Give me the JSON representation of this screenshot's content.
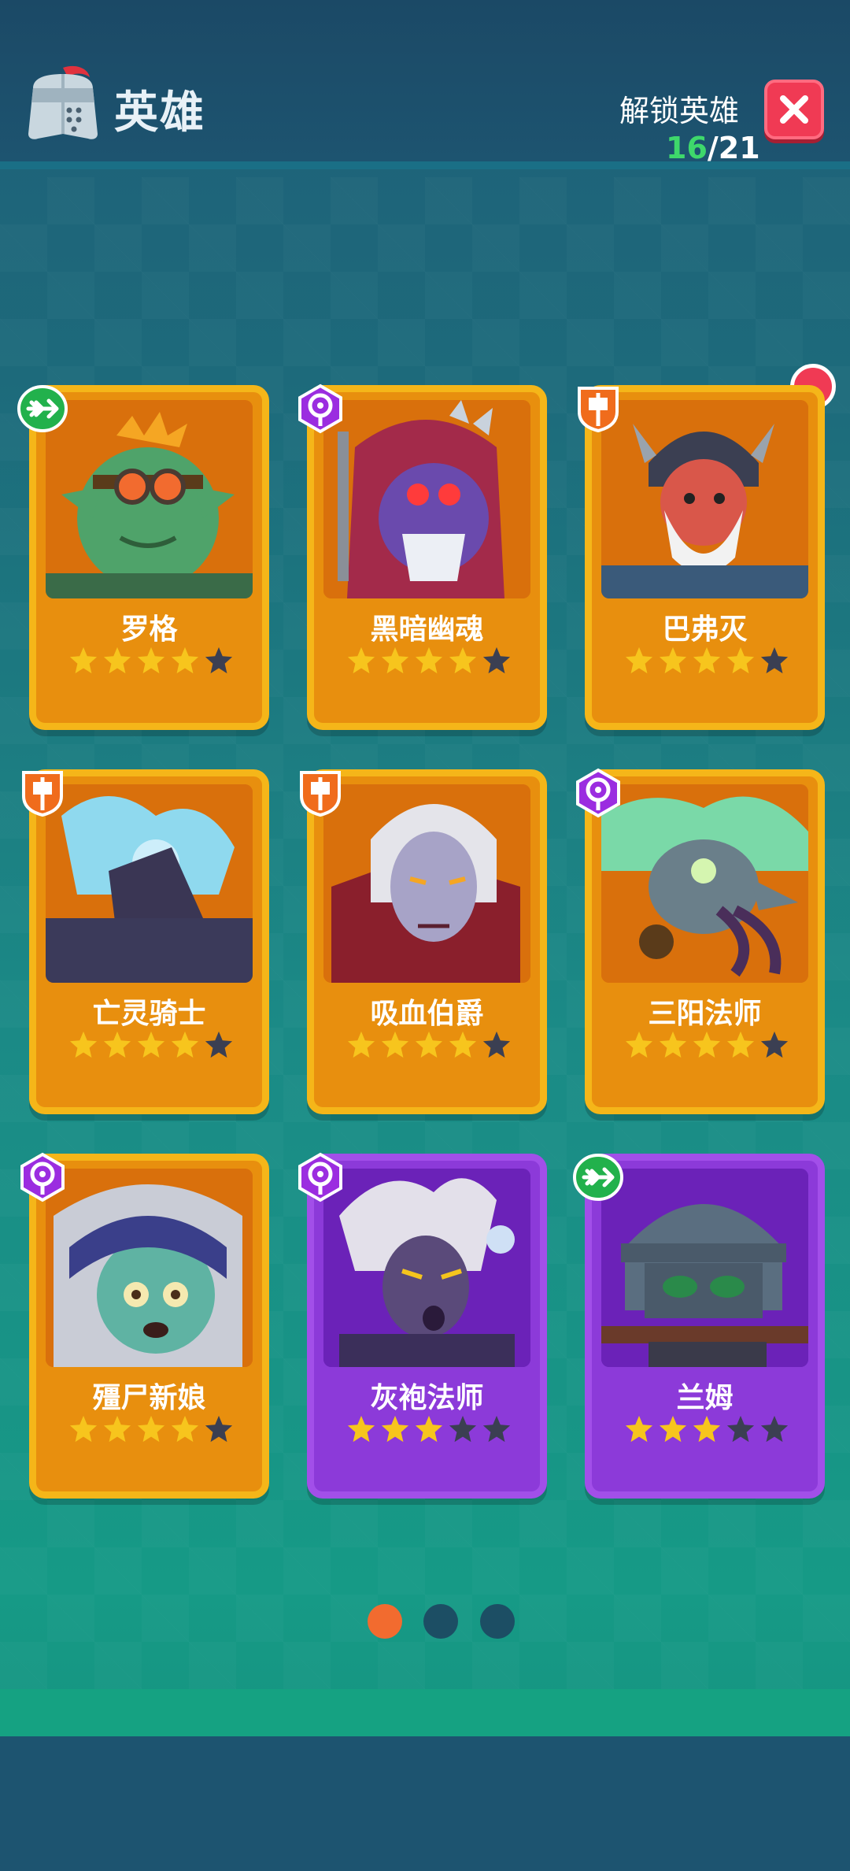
{
  "header": {
    "title": "英雄",
    "unlock_label": "解锁英雄",
    "unlocked": "16",
    "total": "/21",
    "close_icon": "close-icon"
  },
  "heroes": [
    {
      "name": "罗格",
      "stars": 4,
      "max_stars": 5,
      "class": "archer",
      "rarity": "orange"
    },
    {
      "name": "黑暗幽魂",
      "stars": 4,
      "max_stars": 5,
      "class": "mage",
      "rarity": "orange"
    },
    {
      "name": "巴弗灭",
      "stars": 4,
      "max_stars": 5,
      "class": "warrior",
      "rarity": "orange",
      "notification": true
    },
    {
      "name": "亡灵骑士",
      "stars": 4,
      "max_stars": 5,
      "class": "warrior",
      "rarity": "orange"
    },
    {
      "name": "吸血伯爵",
      "stars": 4,
      "max_stars": 5,
      "class": "warrior",
      "rarity": "orange"
    },
    {
      "name": "三阳法师",
      "stars": 4,
      "max_stars": 5,
      "class": "mage",
      "rarity": "orange"
    },
    {
      "name": "殭尸新娘",
      "stars": 4,
      "max_stars": 5,
      "class": "mage",
      "rarity": "orange"
    },
    {
      "name": "灰袍法师",
      "stars": 3,
      "max_stars": 5,
      "class": "mage",
      "rarity": "purple"
    },
    {
      "name": "兰姆",
      "stars": 3,
      "max_stars": 5,
      "class": "archer",
      "rarity": "purple"
    }
  ],
  "pagination": {
    "pages": 3,
    "current": 1
  },
  "colors": {
    "accent_orange": "#f26b2f",
    "dot_inactive": "#1c4e64",
    "star_gold": "#f7c51d",
    "star_empty": "#3b3f52",
    "archer_badge": "#22b14c",
    "mage_badge": "#9b2de0",
    "warrior_badge": "#f06c1c"
  }
}
